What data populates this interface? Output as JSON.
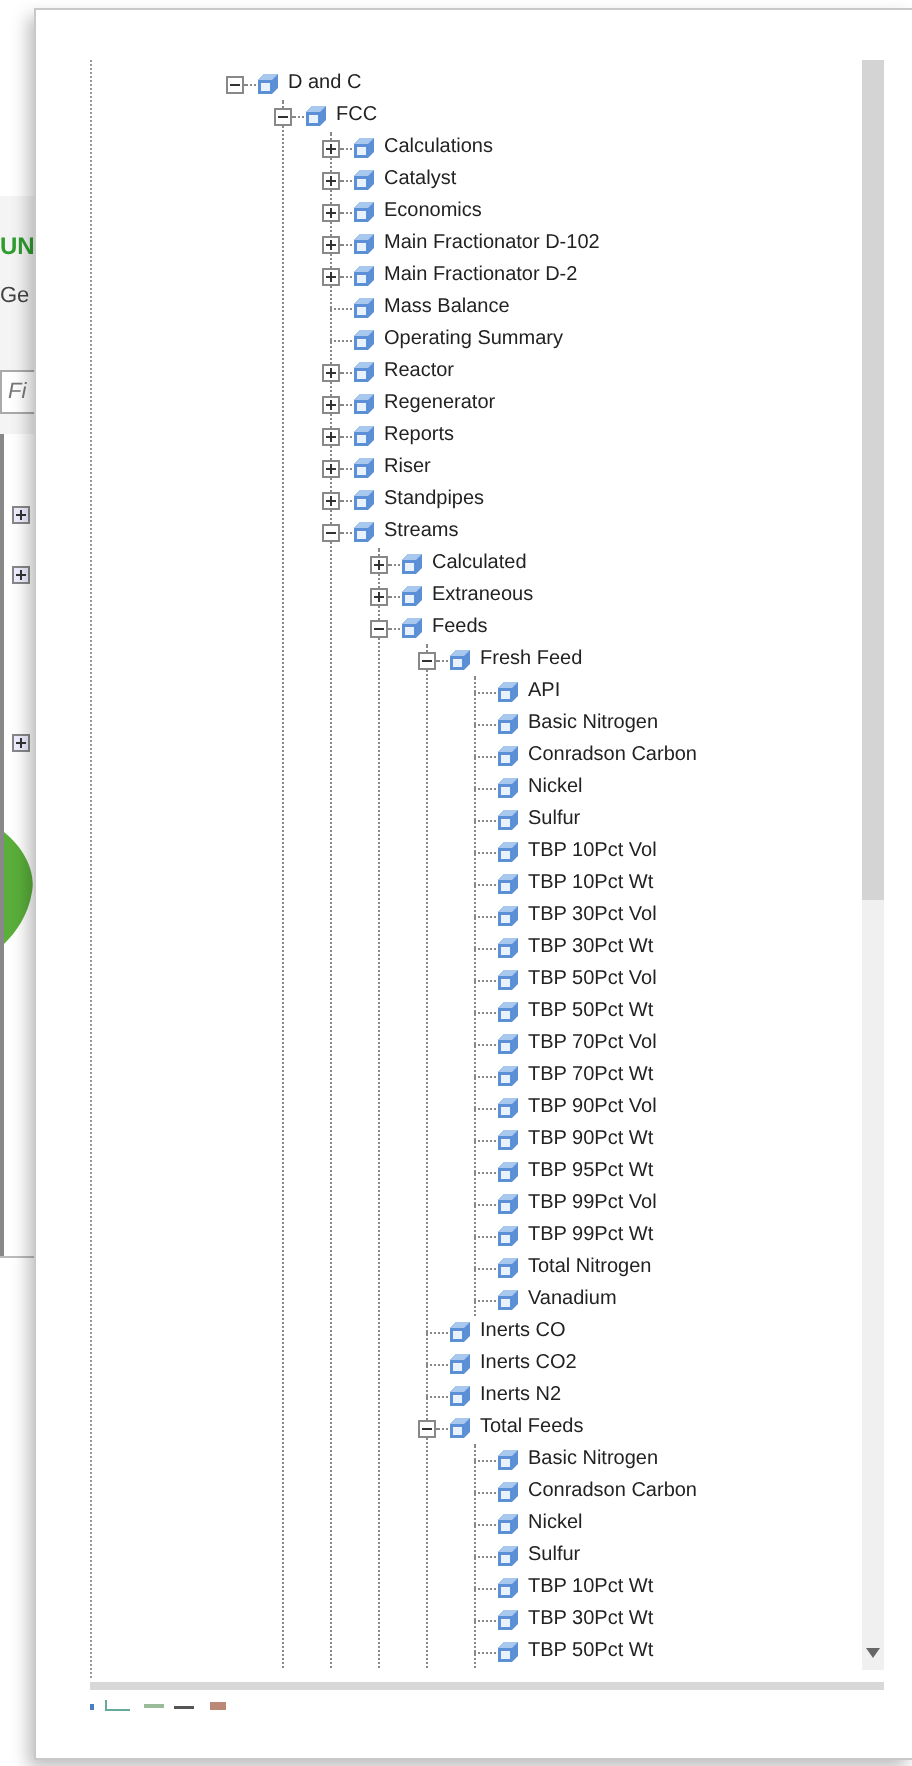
{
  "background_window": {
    "title": "UN",
    "tab": "Ge",
    "search": {
      "placeholder": "Fi"
    },
    "rows": [
      {
        "expanded": false
      },
      {
        "expanded": false
      },
      {
        "expanded": false
      }
    ]
  },
  "tree": {
    "label": "D and C",
    "kind": "group",
    "expanded": true,
    "children": [
      {
        "label": "FCC",
        "kind": "group",
        "expanded": true,
        "children": [
          {
            "label": "Calculations",
            "kind": "group",
            "expanded": false
          },
          {
            "label": "Catalyst",
            "kind": "group",
            "expanded": false
          },
          {
            "label": "Economics",
            "kind": "group",
            "expanded": false
          },
          {
            "label": "Main Fractionator D-102",
            "kind": "group",
            "expanded": false
          },
          {
            "label": "Main Fractionator D-2",
            "kind": "group",
            "expanded": false
          },
          {
            "label": "Mass Balance",
            "kind": "leaf"
          },
          {
            "label": "Operating Summary",
            "kind": "leaf"
          },
          {
            "label": "Reactor",
            "kind": "group",
            "expanded": false
          },
          {
            "label": "Regenerator",
            "kind": "group",
            "expanded": false
          },
          {
            "label": "Reports",
            "kind": "group",
            "expanded": false
          },
          {
            "label": "Riser",
            "kind": "group",
            "expanded": false
          },
          {
            "label": "Standpipes",
            "kind": "group",
            "expanded": false
          },
          {
            "label": "Streams",
            "kind": "group",
            "expanded": true,
            "children": [
              {
                "label": "Calculated",
                "kind": "group",
                "expanded": false
              },
              {
                "label": "Extraneous",
                "kind": "group",
                "expanded": false
              },
              {
                "label": "Feeds",
                "kind": "group",
                "expanded": true,
                "children": [
                  {
                    "label": "Fresh Feed",
                    "kind": "group",
                    "expanded": true,
                    "children": [
                      {
                        "label": "API",
                        "kind": "leaf"
                      },
                      {
                        "label": "Basic Nitrogen",
                        "kind": "leaf"
                      },
                      {
                        "label": "Conradson Carbon",
                        "kind": "leaf"
                      },
                      {
                        "label": "Nickel",
                        "kind": "leaf"
                      },
                      {
                        "label": "Sulfur",
                        "kind": "leaf"
                      },
                      {
                        "label": "TBP 10Pct Vol",
                        "kind": "leaf"
                      },
                      {
                        "label": "TBP 10Pct Wt",
                        "kind": "leaf"
                      },
                      {
                        "label": "TBP 30Pct Vol",
                        "kind": "leaf"
                      },
                      {
                        "label": "TBP 30Pct Wt",
                        "kind": "leaf"
                      },
                      {
                        "label": "TBP 50Pct Vol",
                        "kind": "leaf"
                      },
                      {
                        "label": "TBP 50Pct Wt",
                        "kind": "leaf"
                      },
                      {
                        "label": "TBP 70Pct Vol",
                        "kind": "leaf"
                      },
                      {
                        "label": "TBP 70Pct Wt",
                        "kind": "leaf"
                      },
                      {
                        "label": "TBP 90Pct Vol",
                        "kind": "leaf"
                      },
                      {
                        "label": "TBP 90Pct Wt",
                        "kind": "leaf"
                      },
                      {
                        "label": "TBP 95Pct Wt",
                        "kind": "leaf"
                      },
                      {
                        "label": "TBP 99Pct Vol",
                        "kind": "leaf"
                      },
                      {
                        "label": "TBP 99Pct Wt",
                        "kind": "leaf"
                      },
                      {
                        "label": "Total Nitrogen",
                        "kind": "leaf"
                      },
                      {
                        "label": "Vanadium",
                        "kind": "leaf"
                      }
                    ]
                  },
                  {
                    "label": "Inerts CO",
                    "kind": "leaf"
                  },
                  {
                    "label": "Inerts CO2",
                    "kind": "leaf"
                  },
                  {
                    "label": "Inerts N2",
                    "kind": "leaf"
                  },
                  {
                    "label": "Total Feeds",
                    "kind": "group",
                    "expanded": true,
                    "children": [
                      {
                        "label": "Basic Nitrogen",
                        "kind": "leaf"
                      },
                      {
                        "label": "Conradson Carbon",
                        "kind": "leaf"
                      },
                      {
                        "label": "Nickel",
                        "kind": "leaf"
                      },
                      {
                        "label": "Sulfur",
                        "kind": "leaf"
                      },
                      {
                        "label": "TBP 10Pct Wt",
                        "kind": "leaf"
                      },
                      {
                        "label": "TBP 30Pct Wt",
                        "kind": "leaf"
                      },
                      {
                        "label": "TBP 50Pct Wt",
                        "kind": "leaf"
                      }
                    ]
                  }
                ]
              }
            ]
          }
        ]
      }
    ]
  }
}
